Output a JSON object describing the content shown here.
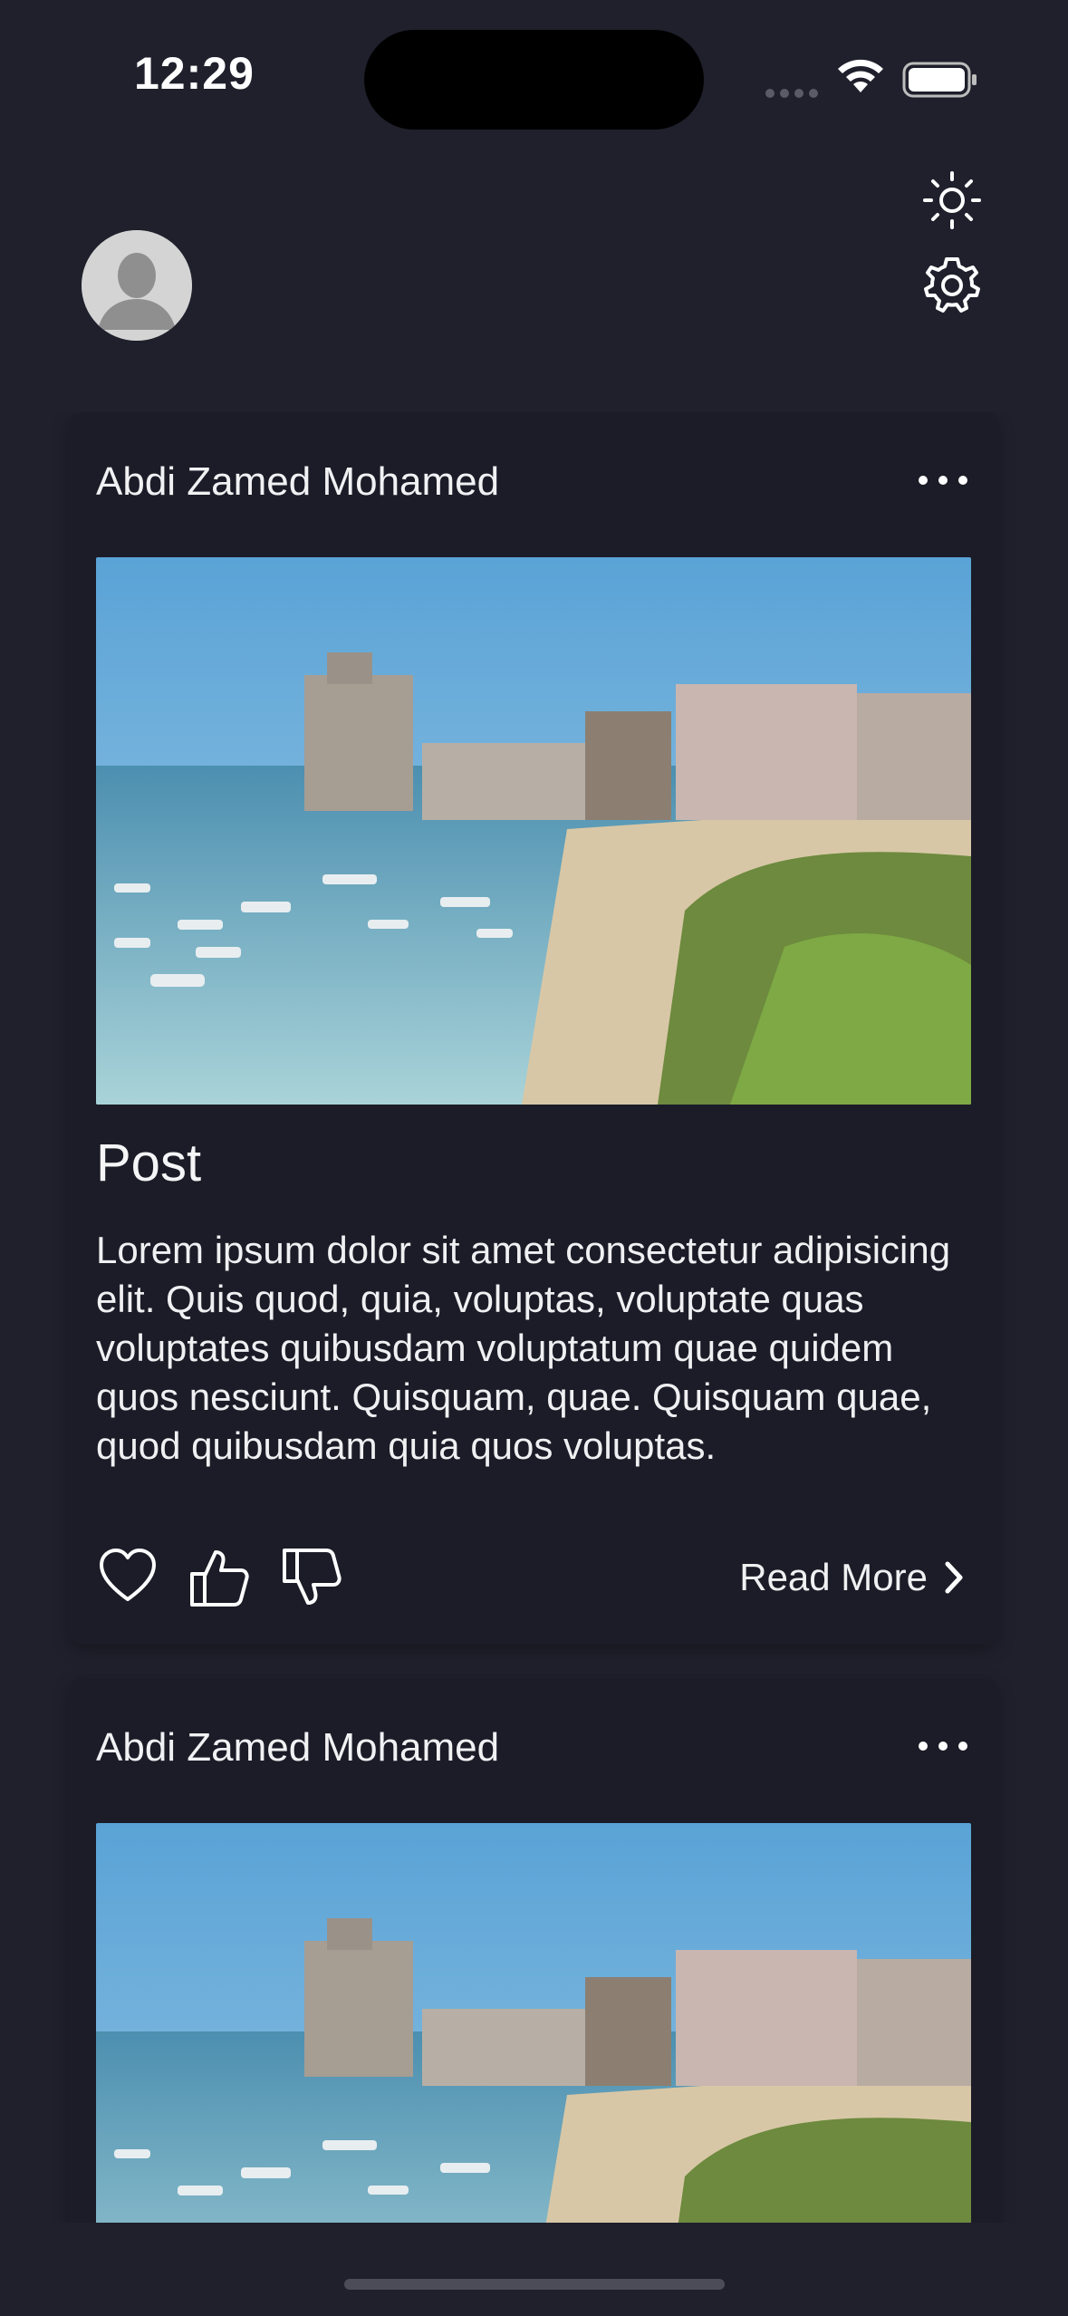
{
  "status_bar": {
    "time": "12:29"
  },
  "header": {
    "avatar_alt": "User avatar"
  },
  "posts": [
    {
      "author": "Abdi Zamed Mohamed",
      "title": "Post",
      "body": "Lorem ipsum dolor sit amet consectetur adipisicing elit. Quis quod, quia, voluptas, voluptate quas voluptates quibusdam voluptatum quae quidem quos nesciunt. Quisquam, quae. Quisquam quae, quod quibusdam quia quos voluptas.",
      "read_more": "Read More"
    },
    {
      "author": "Abdi Zamed Mohamed"
    }
  ],
  "colors": {
    "background": "#1f202c",
    "card": "#1b1c27",
    "text": "#ffffff"
  }
}
